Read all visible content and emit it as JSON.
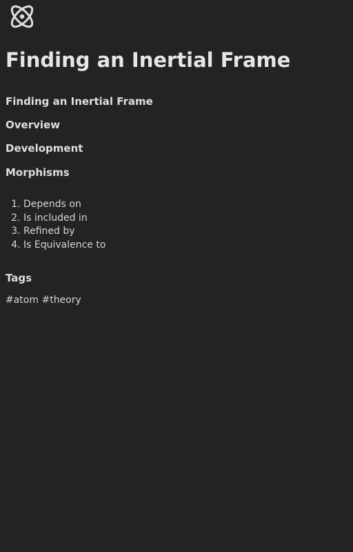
{
  "logo": {
    "icon": "atom-icon",
    "color": "#e0e0e0"
  },
  "page": {
    "title": "Finding an Inertial Frame"
  },
  "toc": {
    "title": "Finding an Inertial Frame",
    "overview": "Overview",
    "development": "Development",
    "morphisms": "Morphisms"
  },
  "morphisms": {
    "items": [
      "Depends on",
      "Is included in",
      "Refined by",
      "Is Equivalence to"
    ]
  },
  "tags": {
    "heading": "Tags",
    "items": [
      "#atom",
      "#theory"
    ]
  },
  "colors": {
    "background": "#232323",
    "text": "#dedede"
  }
}
